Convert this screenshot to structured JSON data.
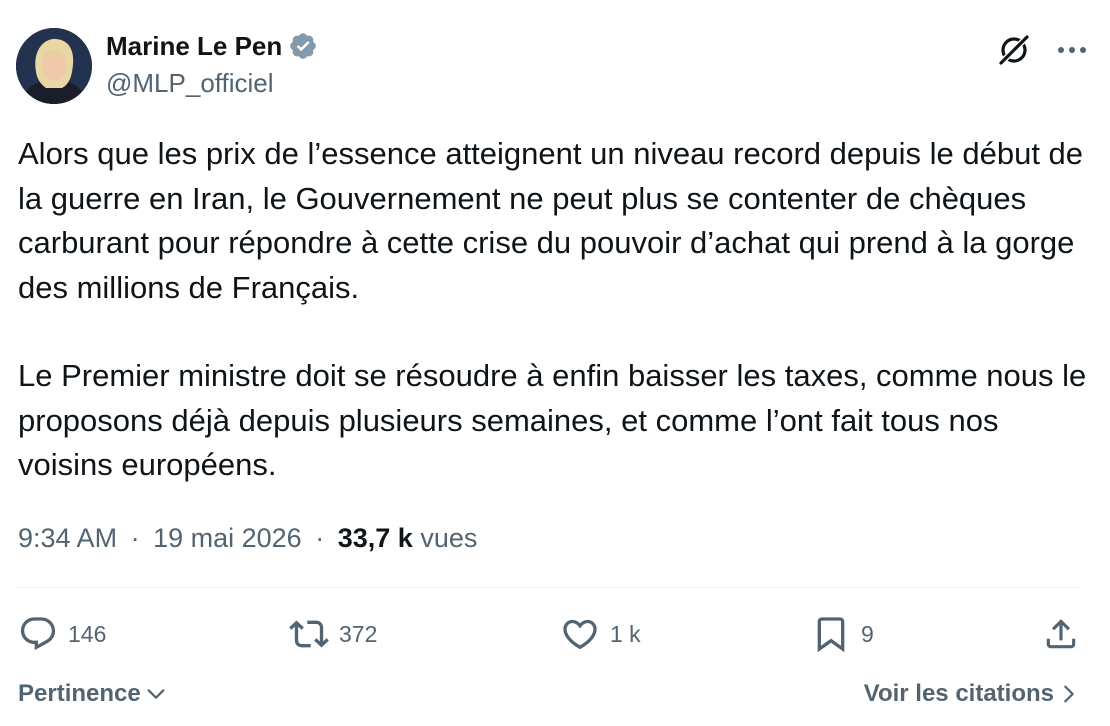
{
  "author": {
    "display_name": "Marine Le Pen",
    "handle": "@MLP_officiel",
    "verified_color": "#829aab"
  },
  "icons": {
    "verified": "verified-badge-icon",
    "grok": "grok-icon",
    "more": "more-options-icon",
    "reply": "reply-icon",
    "repost": "repost-icon",
    "like": "like-icon",
    "bookmark": "bookmark-icon",
    "share": "share-icon"
  },
  "tweet": {
    "paragraph1": "Alors que les prix de l’essence atteignent un niveau record depuis le début de la guerre en Iran, le Gouvernement ne peut plus se contenter de chèques carburant pour répondre à cette crise du pouvoir d’achat qui prend à la gorge des millions de Français.",
    "paragraph2": "Le Premier ministre doit se résoudre à enfin baisser les taxes, comme nous le proposons déjà depuis plusieurs semaines, et comme l’ont fait tous nos voisins européens."
  },
  "meta": {
    "time": "9:34 AM",
    "separator": "·",
    "date": "19 mai 2026",
    "views_count": "33,7 k",
    "views_label": "vues"
  },
  "actions": {
    "reply_count": "146",
    "repost_count": "372",
    "like_count": "1 k",
    "bookmark_count": "9"
  },
  "footer": {
    "sort_label": "Pertinence",
    "quotes_label": "Voir les citations"
  },
  "colors": {
    "text_primary": "#0f1419",
    "text_secondary": "#536471",
    "divider": "#eff3f4"
  }
}
